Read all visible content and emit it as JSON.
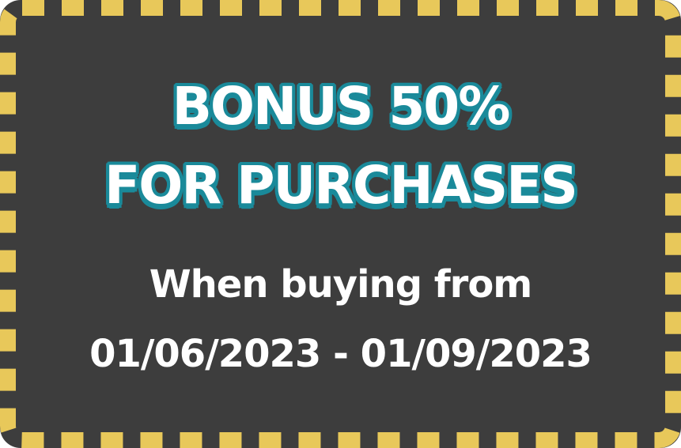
{
  "coupon": {
    "headline_line1": "BONUS 50%",
    "headline_line2": "FOR PURCHASES",
    "subtext_line1": "When buying from",
    "subtext_line2": "01/06/2023 - 01/09/2023"
  },
  "colors": {
    "background": "#3d3d3d",
    "border_dash": "#e8c85a",
    "headline_outline": "#1a8a9a",
    "text": "#ffffff"
  }
}
